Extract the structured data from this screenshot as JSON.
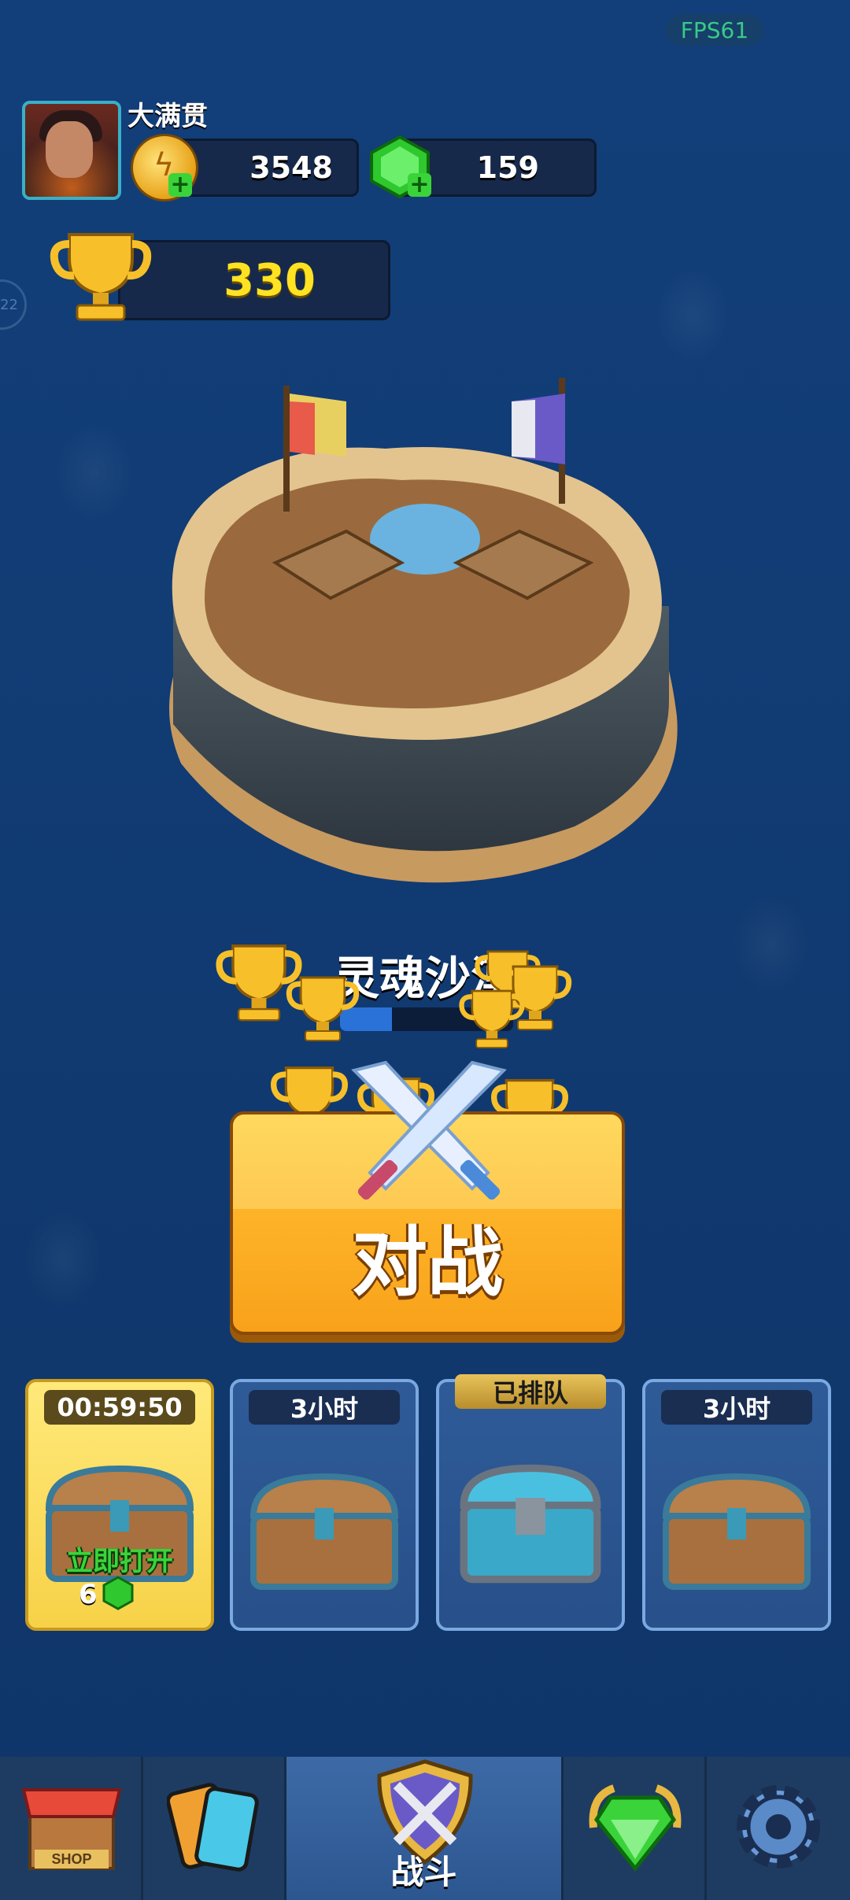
{
  "fps": "FPS61",
  "player": {
    "name": "大满贯"
  },
  "currency": {
    "coins": "3548",
    "gems": "159"
  },
  "trophies": "330",
  "side_badge": "22",
  "arena": {
    "name": "灵魂沙漠",
    "progress": 0.3
  },
  "battle": {
    "label": "对战"
  },
  "chests": [
    {
      "tag": "00:59:50",
      "action": "立即打开",
      "cost": "6"
    },
    {
      "tag": "3小时"
    },
    {
      "tag": "已排队"
    },
    {
      "tag": "3小时"
    }
  ],
  "nav": {
    "shop_sign": "SHOP",
    "battle_label": "战斗",
    "items": [
      "shop",
      "cards",
      "battle",
      "gems",
      "settings"
    ]
  },
  "colors": {
    "background": "#113a72",
    "battle_button": "#fdb328",
    "trophy_value": "#ffe322",
    "gem": "#3ad43a"
  }
}
